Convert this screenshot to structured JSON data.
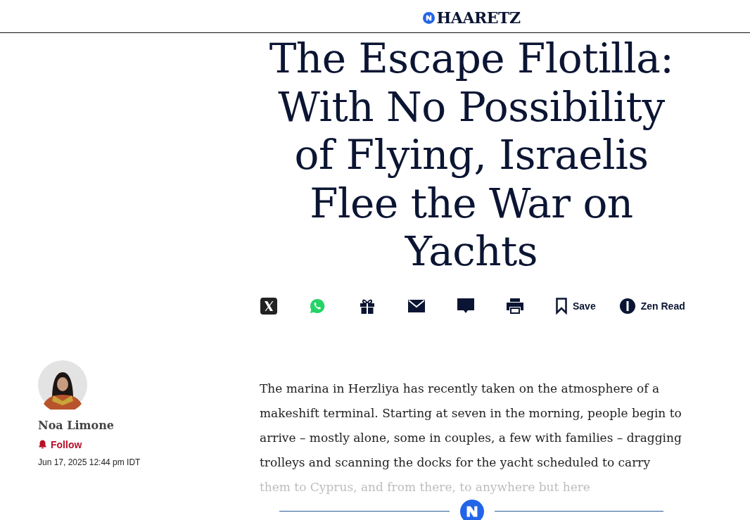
{
  "header": {
    "logo": "HAARETZ"
  },
  "article": {
    "title": "The Escape Flotilla: With No Possibility of Flying, Israelis Flee the War on Yachts",
    "share_bar": [
      {
        "kind": "x"
      },
      {
        "kind": "whatsapp"
      },
      {
        "kind": "gift"
      },
      {
        "kind": "mail"
      },
      {
        "kind": "comment"
      },
      {
        "kind": "print"
      },
      {
        "kind": "save",
        "label": "Save"
      },
      {
        "kind": "zen",
        "label": "Zen Read"
      }
    ],
    "author": {
      "name": "Noa Limone",
      "follow": "Follow",
      "date": "Jun 17, 2025 12:44 pm IDT"
    },
    "body": "The marina in Herzliya has recently taken on the atmosphere of a makeshift terminal. Starting at seven in the morning, people begin to arrive – mostly alone, some in couples, a few with families – dragging trolleys and scanning the docks for the yacht scheduled to carry them to Cyprus, and from there, to anywhere but here"
  }
}
